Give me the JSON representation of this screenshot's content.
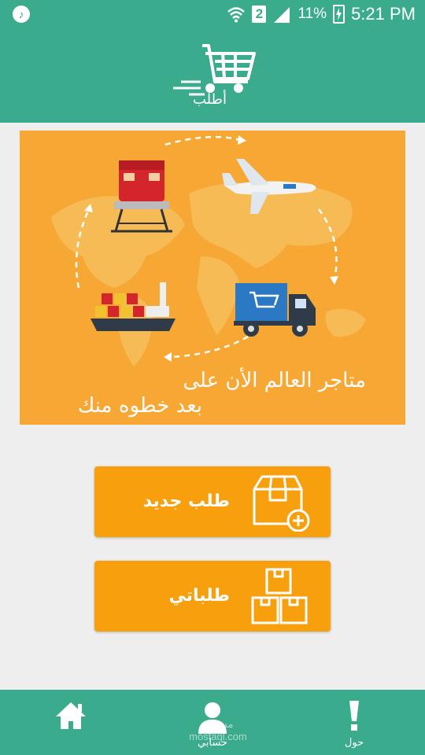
{
  "status_bar": {
    "battery_percent": "11%",
    "sim_slot": "2",
    "time": "5:21 PM",
    "icons": [
      "music-note-icon",
      "wifi-icon",
      "signal-icon",
      "battery-charging-icon"
    ]
  },
  "header": {
    "logo_text": "أطلب",
    "logo_icon": "cart-icon"
  },
  "banner": {
    "line1": "متاجر العالم الأن على",
    "line2": "بعد خطوه منك",
    "background_color": "#f7a733",
    "icons": [
      "train-icon",
      "airplane-icon",
      "ship-icon",
      "truck-icon",
      "world-map-icon"
    ]
  },
  "buttons": {
    "new_order": {
      "label": "طلب جديد",
      "icon": "box-add-icon"
    },
    "my_orders": {
      "label": "طلباتي",
      "icon": "boxes-icon"
    }
  },
  "bottom_nav": {
    "home": {
      "label": "",
      "icon": "home-icon"
    },
    "account": {
      "label": "حسابي",
      "icon": "user-icon"
    },
    "about": {
      "label": "حول",
      "icon": "exclamation-icon"
    }
  },
  "watermark": "مستقل mostaql.com",
  "colors": {
    "primary": "#3aab8c",
    "accent": "#f79f0c",
    "background": "#eeeeee"
  }
}
